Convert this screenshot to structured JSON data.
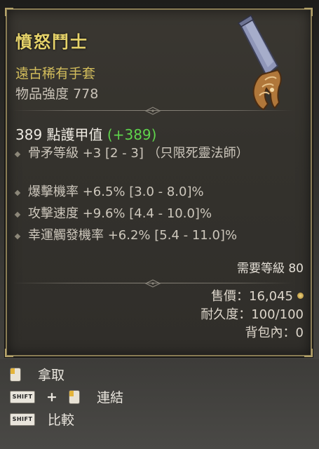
{
  "item": {
    "name": "憤怒鬥士",
    "type": "遠古稀有手套",
    "item_power_label": "物品強度",
    "item_power_value": "778"
  },
  "armor": {
    "value": "389",
    "label": "點護甲值",
    "bonus_open": "(",
    "bonus": "+389",
    "bonus_close": ")"
  },
  "affixes": [
    {
      "text": "骨矛等級 +3 [2 - 3] （只限死靈法師）"
    },
    {
      "text": "爆擊機率 +6.5% [3.0 - 8.0]%"
    },
    {
      "text": "攻擊速度 +9.6% [4.4 - 10.0]%"
    },
    {
      "text": "幸運觸發機率 +6.2% [5.4 - 11.0]%"
    }
  ],
  "requirement": {
    "text": "需要等級 80"
  },
  "meta": {
    "sell_label": "售價：",
    "sell_value": "16,045",
    "durability_label": "耐久度：",
    "durability_value": "100/100",
    "stash_label": "背包內：",
    "stash_value": "0"
  },
  "controls": {
    "pickup": "拿取",
    "shift_key": "SHIFT",
    "plus": "+",
    "link": "連結",
    "compare": "比較"
  },
  "colors": {
    "name": "#e6d36a",
    "rarity": "#d3bd5c",
    "bonus": "#5fd34c",
    "border": "#8a7d55"
  }
}
